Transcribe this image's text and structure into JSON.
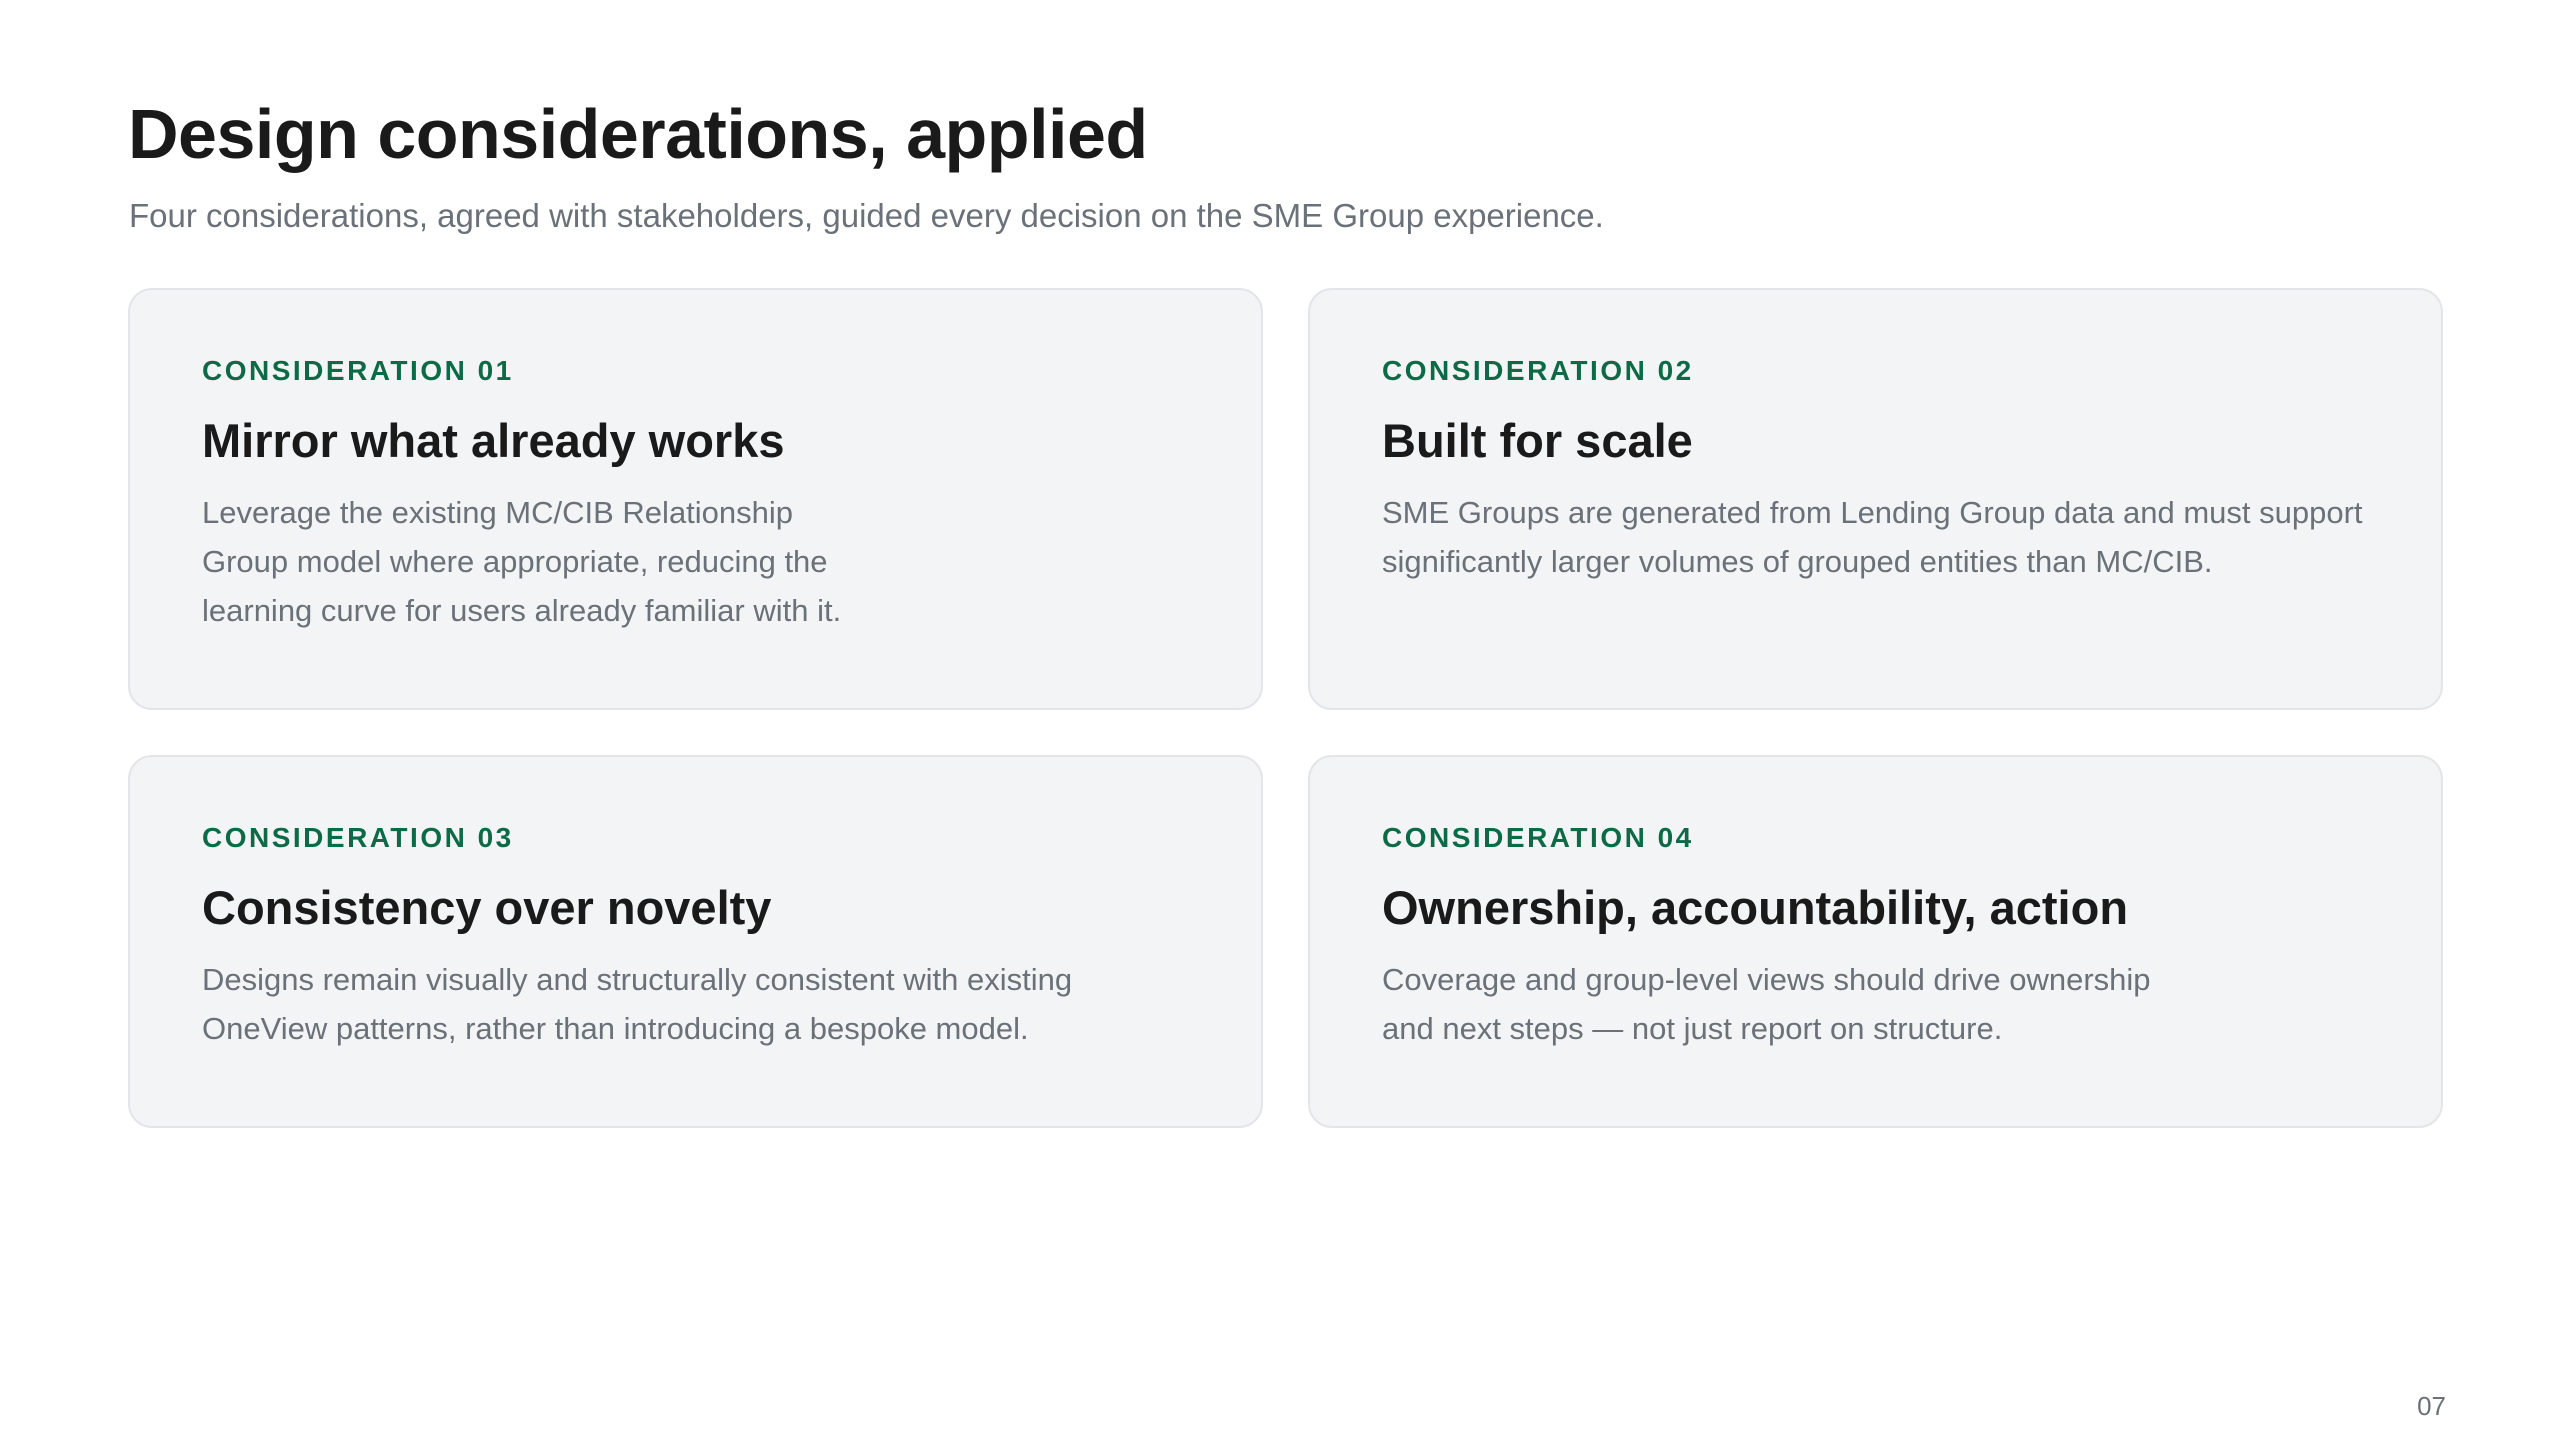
{
  "header": {
    "title": "Design considerations, applied",
    "subtitle": "Four considerations, agreed with stakeholders, guided every decision on the SME Group experience."
  },
  "cards": [
    {
      "eyebrow": "CONSIDERATION 01",
      "title": "Mirror what already works",
      "body": "Leverage the existing MC/CIB Relationship Group model where appropriate, reducing the learning curve for users already familiar with it."
    },
    {
      "eyebrow": "CONSIDERATION 02",
      "title": "Built for scale",
      "body": "SME Groups are generated from Lending Group data and must support significantly larger volumes of grouped entities than MC/CIB."
    },
    {
      "eyebrow": "CONSIDERATION 03",
      "title": "Consistency over novelty",
      "body": "Designs remain visually and structurally consistent with existing OneView patterns, rather than introducing a bespoke model."
    },
    {
      "eyebrow": "CONSIDERATION 04",
      "title": "Ownership, accountability, action",
      "body": "Coverage and group-level views should drive ownership and next steps — not just report on structure."
    }
  ],
  "footer": {
    "page_number": "07"
  },
  "colors": {
    "accent": "#0c6b46",
    "card_background": "#f3f4f5",
    "muted_text": "#6b7178"
  }
}
